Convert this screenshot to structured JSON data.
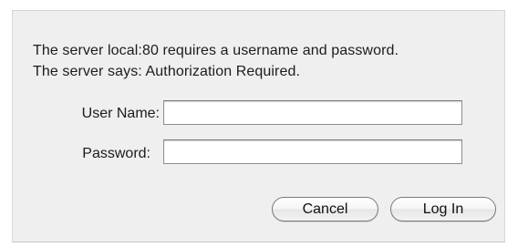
{
  "dialog": {
    "message_line1": "The server local:80 requires a username and password.",
    "message_line2": "The server says: Authorization Required.",
    "username_label": "User Name:",
    "username_value": "",
    "password_label": "Password:",
    "password_value": "",
    "cancel_label": "Cancel",
    "login_label": "Log In"
  }
}
